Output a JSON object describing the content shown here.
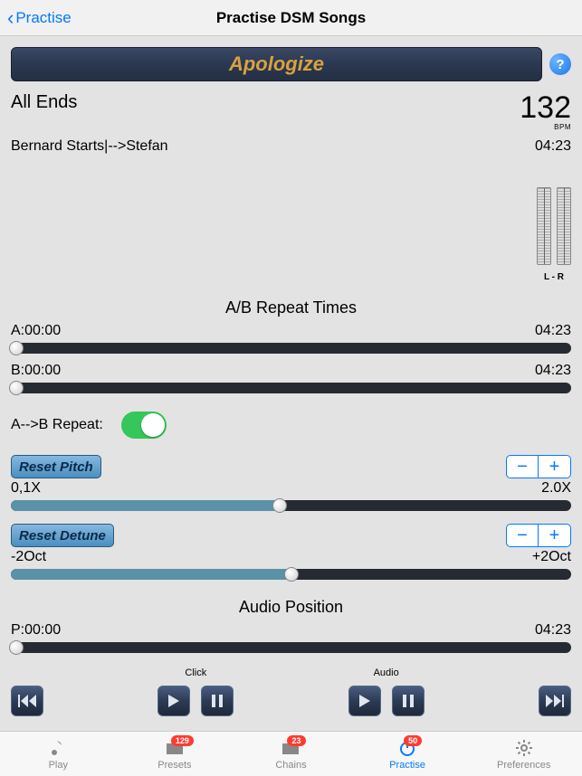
{
  "nav": {
    "back": "Practise",
    "title": "Practise DSM Songs"
  },
  "song_banner": "Apologize",
  "help_glyph": "?",
  "artist": "All Ends",
  "bpm": {
    "value": "132",
    "label": "BPM"
  },
  "info_line": "Bernard Starts|-->Stefan",
  "total_time": "04:23",
  "meters_label": "L - R",
  "ab_section_title": "A/B Repeat Times",
  "sliderA": {
    "left": "A:00:00",
    "right": "04:23"
  },
  "sliderB": {
    "left": "B:00:00",
    "right": "04:23"
  },
  "ab_repeat": {
    "label": "A-->B Repeat:"
  },
  "pitch": {
    "reset": "Reset Pitch",
    "minus": "−",
    "plus": "+",
    "min": "0,1X",
    "max": "2.0X"
  },
  "detune": {
    "reset": "Reset Detune",
    "minus": "−",
    "plus": "+",
    "min": "-2Oct",
    "max": "+2Oct"
  },
  "audio_section_title": "Audio Position",
  "position": {
    "left": "P:00:00",
    "right": "04:23"
  },
  "groups": {
    "click": "Click",
    "audio": "Audio"
  },
  "tabs": {
    "play": {
      "label": "Play"
    },
    "presets": {
      "label": "Presets",
      "badge": "129"
    },
    "chains": {
      "label": "Chains",
      "badge": "23"
    },
    "practise": {
      "label": "Practise",
      "badge": "50"
    },
    "preferences": {
      "label": "Preferences"
    }
  }
}
